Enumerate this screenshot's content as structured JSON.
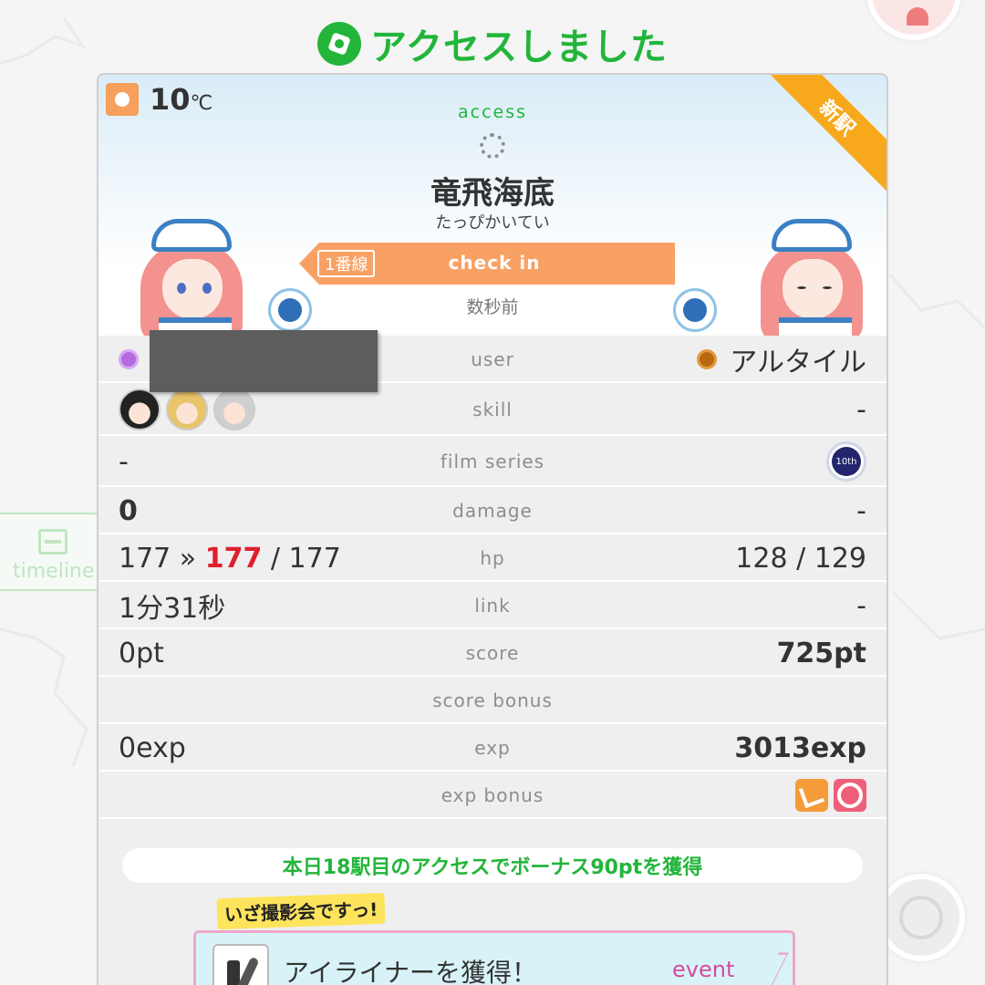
{
  "header": {
    "title": "アクセスしました",
    "icon": "paw-icon"
  },
  "side_tab": {
    "label": "timeline"
  },
  "weather": {
    "temperature": "10",
    "unit": "℃"
  },
  "badge": {
    "label": "新駅"
  },
  "station": {
    "access_label": "access",
    "name": "竜飛海底",
    "kana": "たっぴかいてい",
    "line_tag": "1番線",
    "action_label": "check in",
    "time_ago": "数秒前"
  },
  "rows": {
    "user": {
      "label": "user",
      "right": "アルタイル"
    },
    "skill": {
      "label": "skill",
      "right": "-"
    },
    "film": {
      "label": "film series",
      "left": "-",
      "film_icon_text": "10th"
    },
    "damage": {
      "label": "damage",
      "left": "0",
      "right": "-"
    },
    "hp": {
      "label": "hp",
      "left_before": "177 »",
      "left_current": "177",
      "left_max": "/ 177",
      "right": "128 / 129"
    },
    "link": {
      "label": "link",
      "left": "1分31秒",
      "right": "-"
    },
    "score": {
      "label": "score",
      "left": "0pt",
      "right": "725pt"
    },
    "score_bonus": {
      "label": "score bonus"
    },
    "exp": {
      "label": "exp",
      "left": "0exp",
      "right": "3013exp"
    },
    "exp_bonus": {
      "label": "exp bonus"
    }
  },
  "bonus_banner": "本日18駅目のアクセスでボーナス90ptを獲得",
  "event": {
    "logo": "いざ撮影会ですっ!",
    "item_label": "アイライナーを獲得！",
    "tag": "event"
  },
  "colors": {
    "accent_green": "#22b53a",
    "orange": "#f9a165",
    "badge_yellow": "#f7a81b",
    "red": "#e01f2d"
  }
}
